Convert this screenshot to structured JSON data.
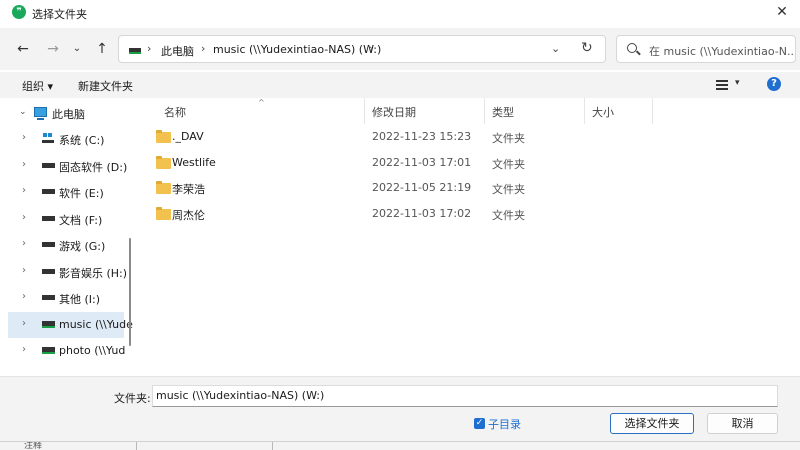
{
  "window": {
    "title": "选择文件夹",
    "app_icon": "clip-icon",
    "close_glyph": "✕"
  },
  "nav": {
    "back_glyph": "←",
    "forward_glyph": "→",
    "recent_glyph": "⌄",
    "up_glyph": "↑"
  },
  "address": {
    "segments": [
      "此电脑",
      "music (\\\\Yudexintiao-NAS) (W:)"
    ],
    "separator": "›",
    "dropdown_glyph": "⌄",
    "refresh_glyph": "↻"
  },
  "search": {
    "placeholder": "在 music (\\\\Yudexintiao-N..."
  },
  "toolbar": {
    "organize_label": "组织 ▾",
    "new_folder_label": "新建文件夹",
    "view_dropdown": "▾",
    "help_glyph": "?"
  },
  "sidebar": {
    "expand_glyph": "›",
    "open_glyph": "⌄",
    "items": [
      {
        "label": "此电脑",
        "icon": "pc-icon"
      },
      {
        "label": "系统 (C:)",
        "icon": "windows-drive-icon"
      },
      {
        "label": "固态软件 (D:)",
        "icon": "drive-icon"
      },
      {
        "label": "软件 (E:)",
        "icon": "drive-icon"
      },
      {
        "label": "文档 (F:)",
        "icon": "drive-icon"
      },
      {
        "label": "游戏 (G:)",
        "icon": "drive-icon"
      },
      {
        "label": "影音娱乐 (H:)",
        "icon": "drive-icon"
      },
      {
        "label": "其他 (I:)",
        "icon": "drive-icon"
      },
      {
        "label": "music (\\\\Yude",
        "icon": "network-drive-icon",
        "selected": true
      },
      {
        "label": "photo (\\\\Yud",
        "icon": "network-drive-icon"
      }
    ]
  },
  "columns": {
    "name": "名称",
    "date": "修改日期",
    "type": "类型",
    "size": "大小",
    "sort_glyph": "^"
  },
  "files": [
    {
      "name": "._DAV",
      "date": "2022-11-23 15:23",
      "type": "文件夹"
    },
    {
      "name": "Westlife",
      "date": "2022-11-03 17:01",
      "type": "文件夹"
    },
    {
      "name": "李荣浩",
      "date": "2022-11-05 21:19",
      "type": "文件夹"
    },
    {
      "name": "周杰伦",
      "date": "2022-11-03 17:02",
      "type": "文件夹"
    }
  ],
  "footer": {
    "folder_label": "文件夹:",
    "folder_value": "music (\\\\Yudexintiao-NAS) (W:)",
    "subdir_label": "子目录",
    "subdir_checked": true,
    "check_glyph": "✓",
    "select_button": "选择文件夹",
    "cancel_button": "取消"
  },
  "background_window": {
    "text": "注释"
  },
  "colors": {
    "accent": "#1f6fd1",
    "selected": "#dfeaf7",
    "folder": "#f2c14e",
    "nas_green": "#19a046",
    "app_icon": "#1aa85a"
  }
}
